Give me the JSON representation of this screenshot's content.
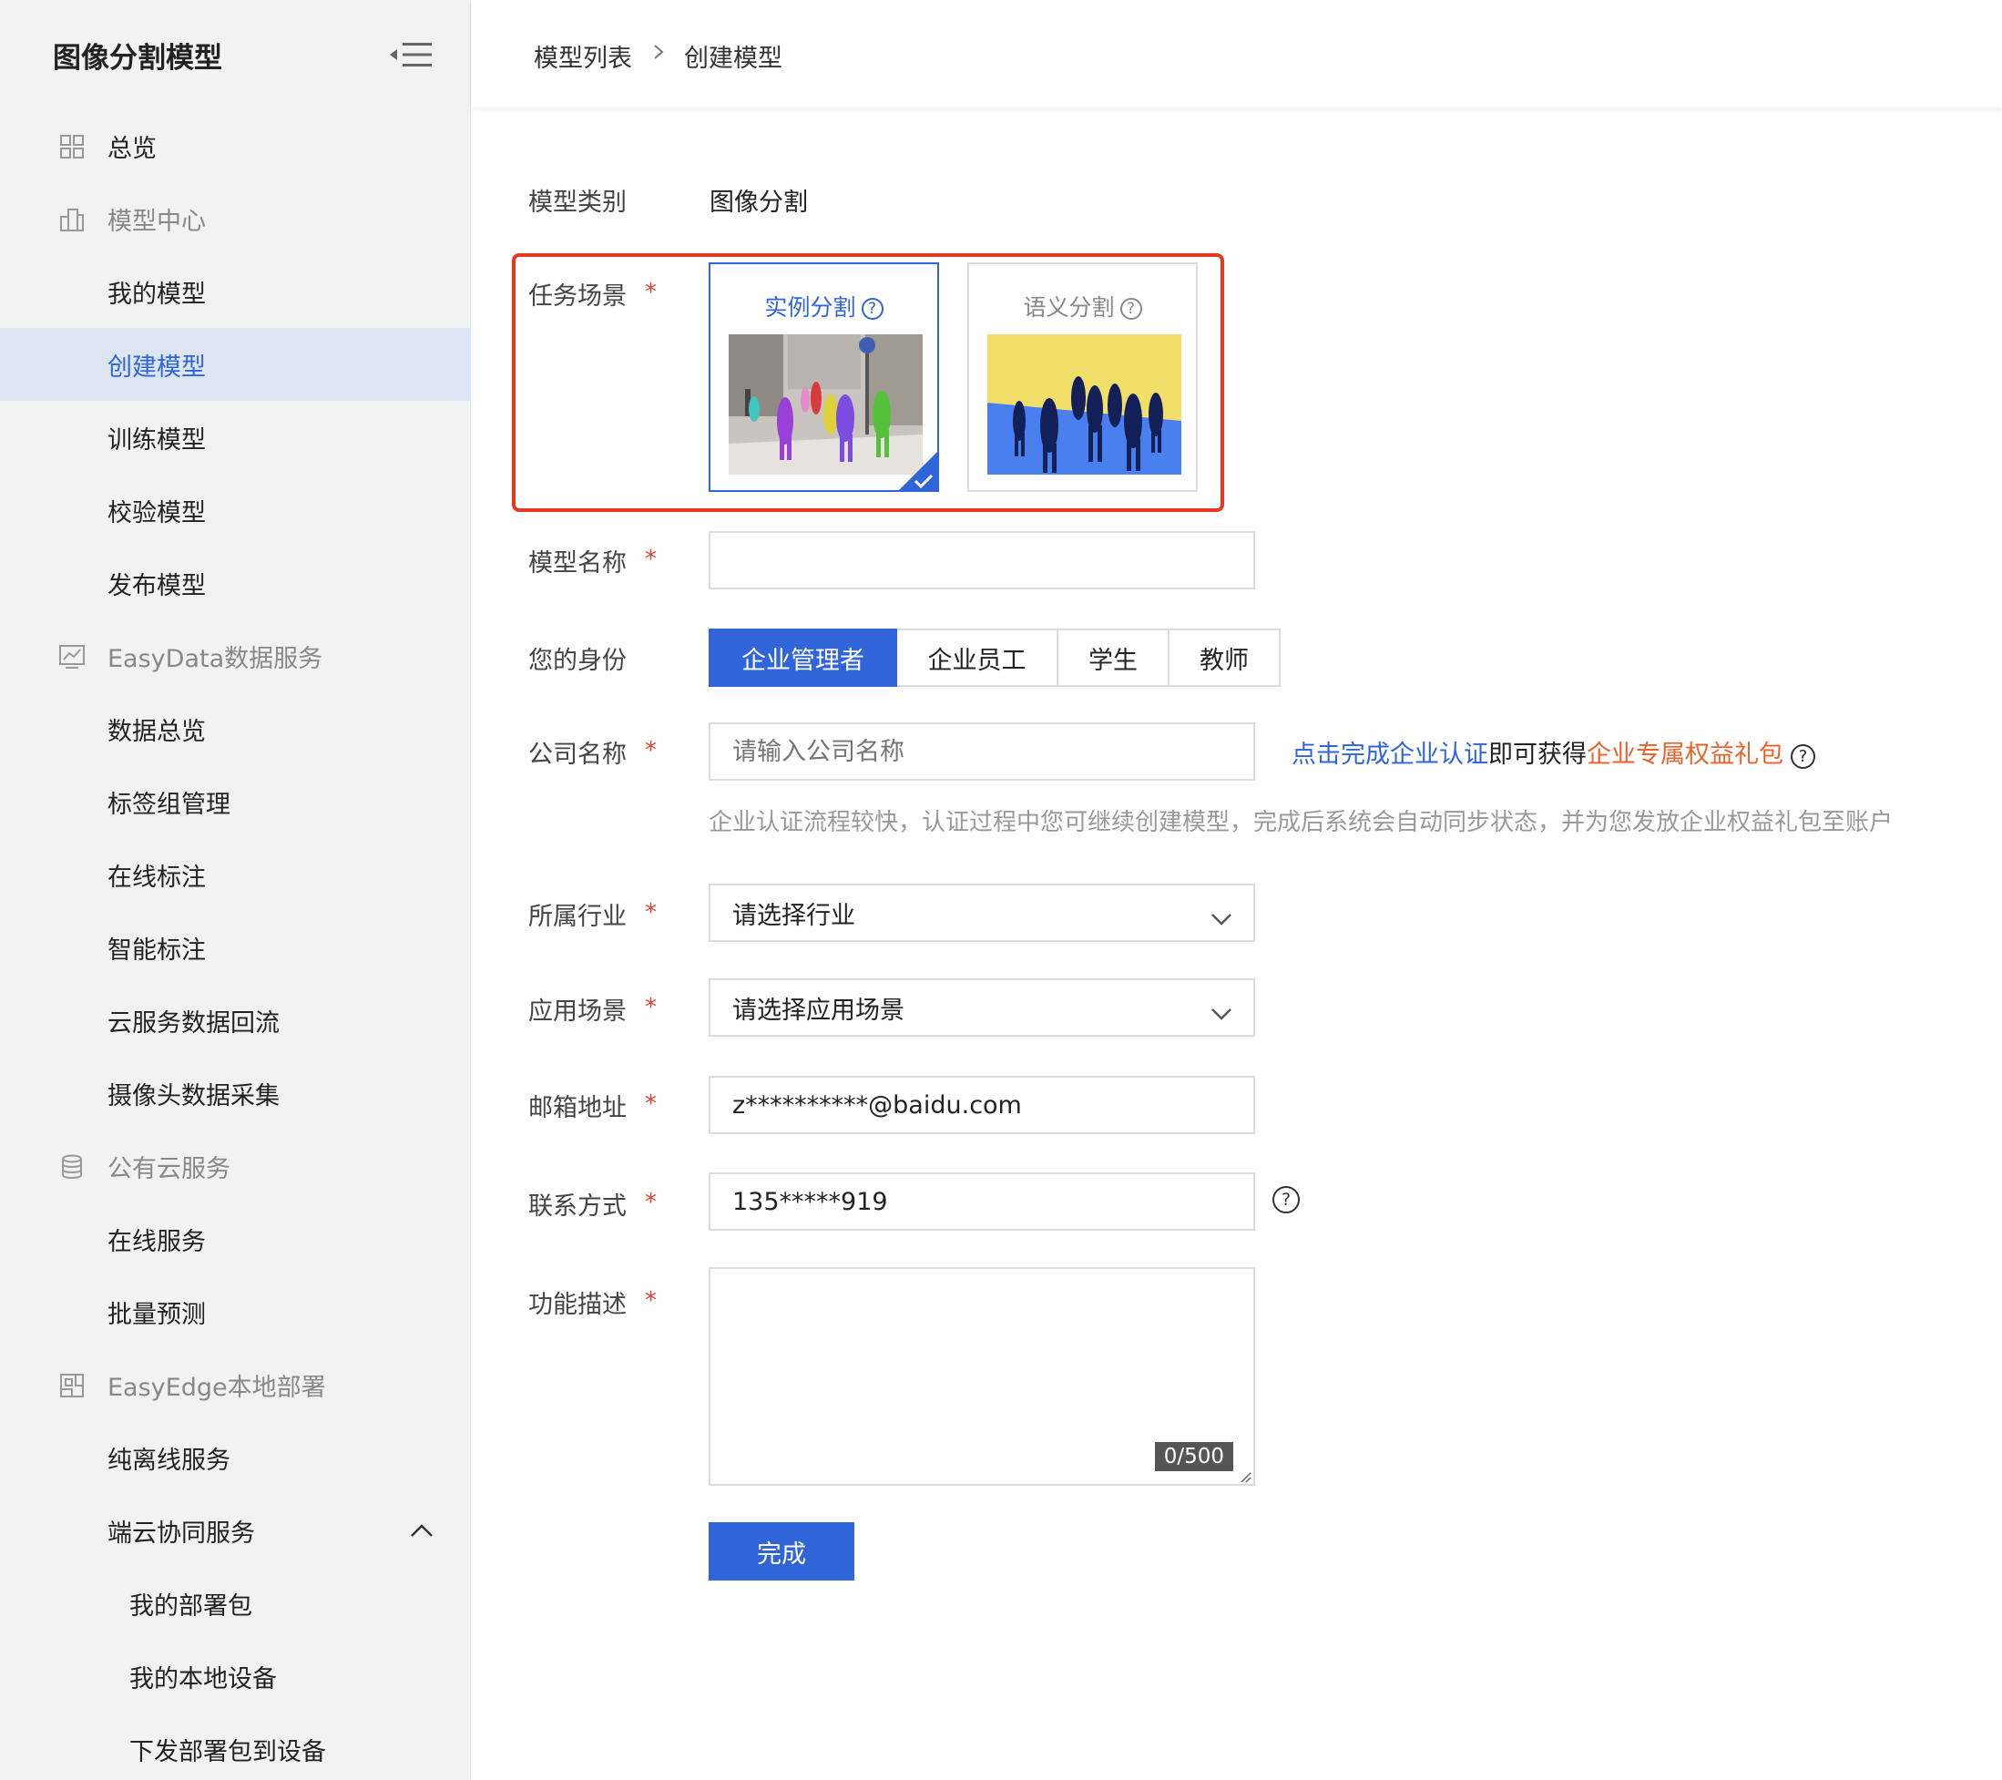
{
  "sidebar": {
    "title": "图像分割模型",
    "items": [
      {
        "label": "总览",
        "kind": "group-top",
        "icon": "grid-icon"
      },
      {
        "label": "模型中心",
        "kind": "group",
        "icon": "building-icon"
      },
      {
        "label": "我的模型",
        "kind": "sub"
      },
      {
        "label": "创建模型",
        "kind": "sub",
        "active": true
      },
      {
        "label": "训练模型",
        "kind": "sub"
      },
      {
        "label": "校验模型",
        "kind": "sub"
      },
      {
        "label": "发布模型",
        "kind": "sub"
      },
      {
        "label": "EasyData数据服务",
        "kind": "group",
        "icon": "chart-icon"
      },
      {
        "label": "数据总览",
        "kind": "sub"
      },
      {
        "label": "标签组管理",
        "kind": "sub"
      },
      {
        "label": "在线标注",
        "kind": "sub"
      },
      {
        "label": "智能标注",
        "kind": "sub"
      },
      {
        "label": "云服务数据回流",
        "kind": "sub"
      },
      {
        "label": "摄像头数据采集",
        "kind": "sub"
      },
      {
        "label": "公有云服务",
        "kind": "group",
        "icon": "database-icon"
      },
      {
        "label": "在线服务",
        "kind": "sub"
      },
      {
        "label": "批量预测",
        "kind": "sub"
      },
      {
        "label": "EasyEdge本地部署",
        "kind": "group",
        "icon": "deploy-icon"
      },
      {
        "label": "纯离线服务",
        "kind": "sub"
      },
      {
        "label": "端云协同服务",
        "kind": "sub",
        "expanded": true
      },
      {
        "label": "我的部署包",
        "kind": "sub3"
      },
      {
        "label": "我的本地设备",
        "kind": "sub3"
      },
      {
        "label": "下发部署包到设备",
        "kind": "sub3"
      }
    ]
  },
  "breadcrumb": {
    "parent": "模型列表",
    "current": "创建模型"
  },
  "form": {
    "model_type_label": "模型类别",
    "model_type_value": "图像分割",
    "scene_label": "任务场景",
    "scenes": {
      "instance": {
        "label": "实例分割",
        "selected": true
      },
      "semantic": {
        "label": "语义分割",
        "selected": false
      }
    },
    "model_name_label": "模型名称",
    "model_name_value": "",
    "identity_label": "您的身份",
    "identities": [
      "企业管理者",
      "企业员工",
      "学生",
      "教师"
    ],
    "identity_selected": "企业管理者",
    "company_label": "公司名称",
    "company_placeholder": "请输入公司名称",
    "auth_link": "点击完成企业认证",
    "auth_middle": "即可获得",
    "auth_gift": "企业专属权益礼包",
    "company_hint": "企业认证流程较快，认证过程中您可继续创建模型，完成后系统会自动同步状态，并为您发放企业权益礼包至账户",
    "industry_label": "所属行业",
    "industry_placeholder": "请选择行业",
    "app_scene_label": "应用场景",
    "app_scene_placeholder": "请选择应用场景",
    "email_label": "邮箱地址",
    "email_value": "z**********@baidu.com",
    "contact_label": "联系方式",
    "contact_value": "135*****919",
    "desc_label": "功能描述",
    "desc_counter": "0/500",
    "required_mark": "*",
    "help_mark": "?",
    "submit_label": "完成"
  },
  "colors": {
    "primary": "#2f65d8",
    "required": "#e0432f",
    "highlight": "#e5391f",
    "gift": "#e8632b",
    "sidebar_bg": "#f2f2f2",
    "sidebar_active_bg": "#dde5f3"
  }
}
